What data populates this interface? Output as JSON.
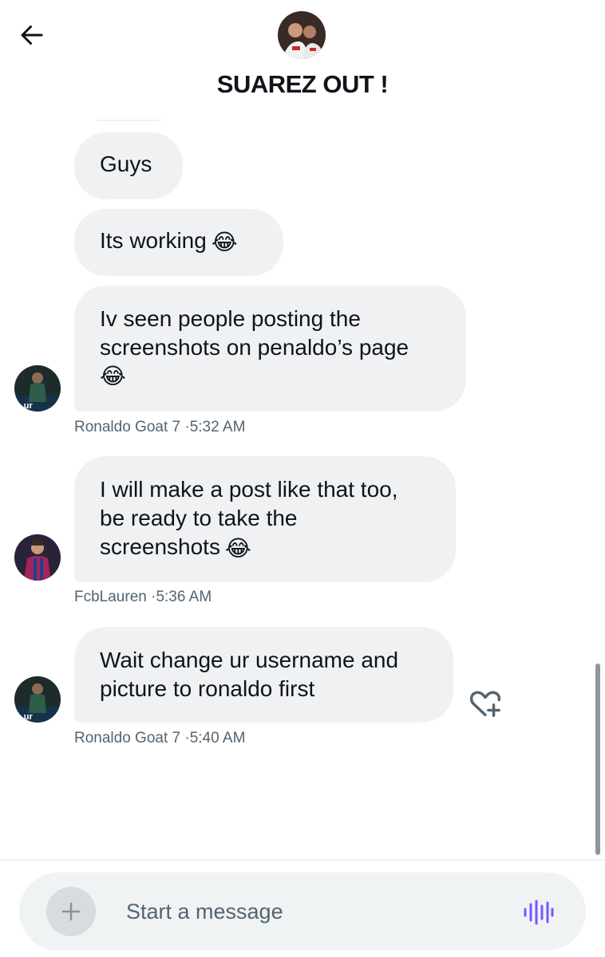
{
  "header": {
    "title": "SUAREZ OUT !",
    "back_icon": "arrow-left-icon",
    "group_avatar": "group-avatar"
  },
  "messages": [
    {
      "text": "Guys",
      "sender": "",
      "time": ""
    },
    {
      "text": "Its working",
      "emoji": "😂",
      "sender": "",
      "time": ""
    },
    {
      "lines": [
        "Iv seen people posting the",
        "screenshots on penaldo’s page"
      ],
      "emoji": "😂",
      "sender": "Ronaldo Goat 7",
      "time": "5:32 AM"
    },
    {
      "lines": [
        "I will make a post like that too,",
        "be ready to take the",
        "screenshots"
      ],
      "emoji": "😂",
      "sender": "FcbLauren",
      "time": "5:36 AM"
    },
    {
      "lines": [
        "Wait change ur username and",
        "picture to ronaldo first"
      ],
      "sender": "Ronaldo Goat 7",
      "time": "5:40 AM"
    }
  ],
  "meta_separator": " ·",
  "composer": {
    "placeholder": "Start a message",
    "add_icon": "plus-icon",
    "voice_icon": "voice-wave-icon"
  },
  "colors": {
    "bubble": "#eff1f3",
    "accent": "#7856ff",
    "meta_text": "#536471"
  }
}
